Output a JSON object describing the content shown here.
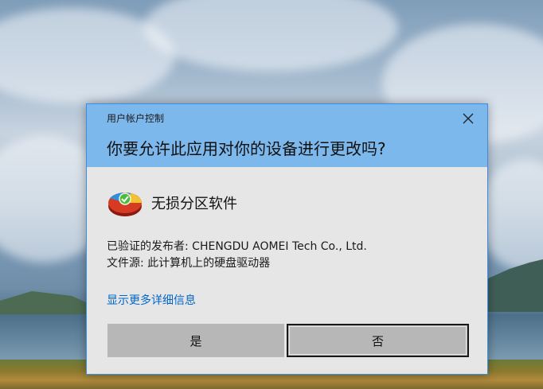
{
  "dialog": {
    "title": "用户帐户控制",
    "question": "你要允许此应用对你的设备进行更改吗?",
    "close_icon": "close-icon",
    "app_icon": "disk-partition-icon",
    "app_name": "无损分区软件",
    "publisher_line": "已验证的发布者: CHENGDU AOMEI Tech Co., Ltd.",
    "source_line": "文件源: 此计算机上的硬盘驱动器",
    "more_link": "显示更多详细信息",
    "yes_label": "是",
    "no_label": "否"
  },
  "colors": {
    "header": "#7cb8ec",
    "body": "#e6e6e6",
    "link": "#0066cc",
    "button": "#b7b7b7"
  }
}
